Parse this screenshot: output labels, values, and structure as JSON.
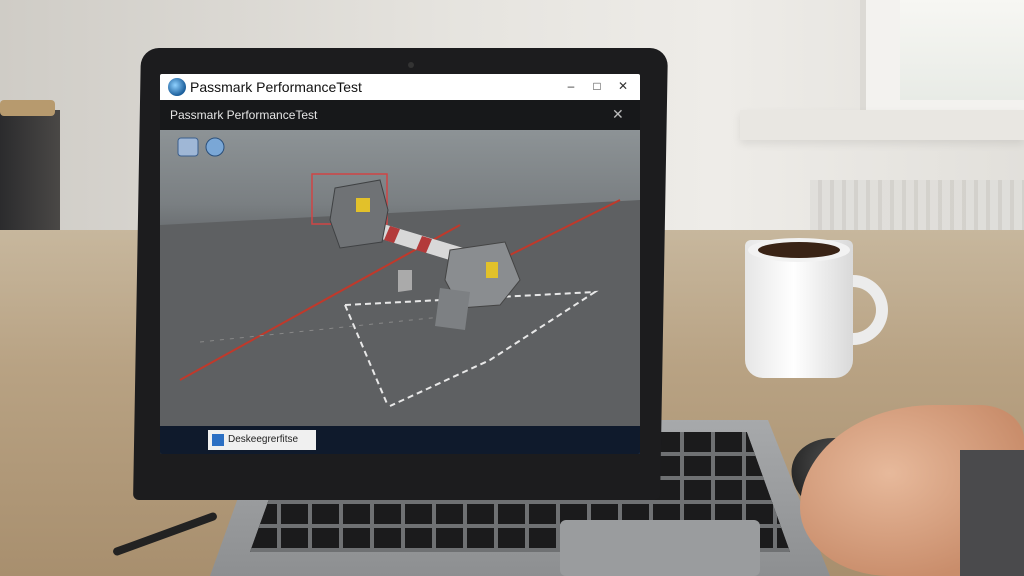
{
  "window": {
    "title": "Passmark PerformanceTest",
    "menu_text": "Passmark   PerformanceTest",
    "controls": {
      "minimize": "–",
      "maximize": "□",
      "close": "✕"
    },
    "menu_close": "✕"
  },
  "taskbar": {
    "item_label": "Deskeegrerfitse"
  },
  "icons": {
    "app_logo": "passmark-logo-icon",
    "toolbar": [
      "save-icon",
      "refresh-icon"
    ]
  },
  "colors": {
    "menubar": "#17181a",
    "viewport_floor": "#5e6062",
    "grid_red": "#c0392b",
    "taskbar": "#0f1a2c"
  }
}
